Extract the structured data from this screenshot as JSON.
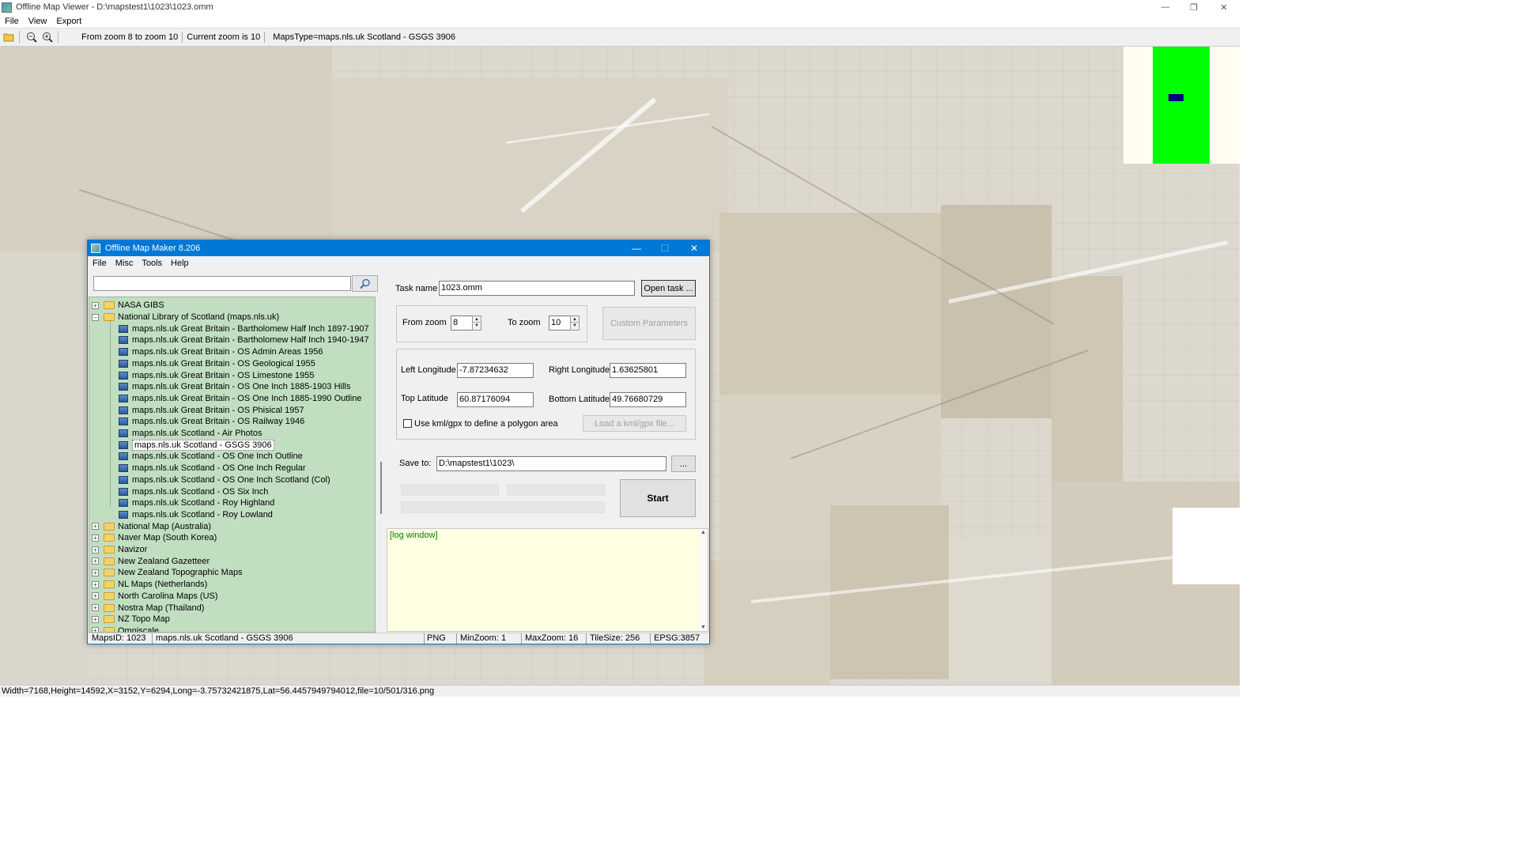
{
  "window": {
    "title": "Offline Map Viewer - D:\\mapstest1\\1023\\1023.omm",
    "controls": {
      "minimize": "—",
      "restore": "❐",
      "close": "✕"
    }
  },
  "menu": [
    "File",
    "View",
    "Export"
  ],
  "toolbar": {
    "icons": [
      "open-folder-icon",
      "zoom-out-icon",
      "zoom-in-icon"
    ],
    "zoom_range": "From zoom 8 to zoom 10",
    "current_zoom": "Current zoom is 10",
    "maps_type": "MapsType=maps.nls.uk Scotland - GSGS 3906"
  },
  "status": "Width=7168,Height=14592,X=3152,Y=6294,Long=-3.75732421875,Lat=56.4457949794012,file=10/501/316.png",
  "colors": {
    "overview_bg": "#fffdf0",
    "overview_area": "#00ff00",
    "overview_marker": "#000080",
    "tree_bg": "#c1dec1",
    "dialog_titlebar": "#0078d7",
    "log_bg": "#ffffe1"
  },
  "dialog": {
    "title": "Offline Map Maker 8.206",
    "controls": {
      "minimize": "—",
      "maximize": "☐",
      "close": "✕"
    },
    "menu": [
      "File",
      "Misc",
      "Tools",
      "Help"
    ],
    "search_value": "",
    "search_icon": "magnifier-icon",
    "tree": [
      {
        "label": "NASA GIBS",
        "type": "folder",
        "expanded": false
      },
      {
        "label": "National Library of Scotland (maps.nls.uk)",
        "type": "folder",
        "expanded": true
      },
      {
        "label": "maps.nls.uk Great Britain - Bartholomew Half Inch 1897-1907",
        "type": "leaf"
      },
      {
        "label": "maps.nls.uk Great Britain - Bartholomew Half Inch 1940-1947",
        "type": "leaf"
      },
      {
        "label": "maps.nls.uk Great Britain - OS Admin Areas 1956",
        "type": "leaf"
      },
      {
        "label": "maps.nls.uk Great Britain - OS Geological 1955",
        "type": "leaf"
      },
      {
        "label": "maps.nls.uk Great Britain - OS Limestone 1955",
        "type": "leaf"
      },
      {
        "label": "maps.nls.uk Great Britain - OS One Inch 1885-1903 Hills",
        "type": "leaf"
      },
      {
        "label": "maps.nls.uk Great Britain - OS One Inch 1885-1990 Outline",
        "type": "leaf"
      },
      {
        "label": "maps.nls.uk Great Britain - OS Phisical 1957",
        "type": "leaf"
      },
      {
        "label": "maps.nls.uk Great Britain - OS Railway 1946",
        "type": "leaf"
      },
      {
        "label": "maps.nls.uk Scotland - Air Photos",
        "type": "leaf"
      },
      {
        "label": "maps.nls.uk Scotland - GSGS 3906",
        "type": "leaf",
        "selected": true
      },
      {
        "label": "maps.nls.uk Scotland - OS One Inch Outline",
        "type": "leaf"
      },
      {
        "label": "maps.nls.uk Scotland - OS One Inch Regular",
        "type": "leaf"
      },
      {
        "label": "maps.nls.uk Scotland - OS One Inch Scotland (Col)",
        "type": "leaf"
      },
      {
        "label": "maps.nls.uk Scotland - OS Six Inch",
        "type": "leaf"
      },
      {
        "label": "maps.nls.uk Scotland - Roy Highland",
        "type": "leaf"
      },
      {
        "label": "maps.nls.uk Scotland - Roy Lowland",
        "type": "leaf"
      },
      {
        "label": "National Map (Australia)",
        "type": "folder",
        "expanded": false
      },
      {
        "label": "Naver Map (South Korea)",
        "type": "folder",
        "expanded": false
      },
      {
        "label": "Navizor",
        "type": "folder",
        "expanded": false
      },
      {
        "label": "New Zealand Gazetteer",
        "type": "folder",
        "expanded": false
      },
      {
        "label": "New Zealand Topographic Maps",
        "type": "folder",
        "expanded": false
      },
      {
        "label": "NL Maps (Netherlands)",
        "type": "folder",
        "expanded": false
      },
      {
        "label": "North Carolina Maps (US)",
        "type": "folder",
        "expanded": false
      },
      {
        "label": "Nostra Map (Thailand)",
        "type": "folder",
        "expanded": false
      },
      {
        "label": "NZ Topo Map",
        "type": "folder",
        "expanded": false
      },
      {
        "label": "Omniscale",
        "type": "folder",
        "expanded": false
      }
    ],
    "task_name_label": "Task name",
    "task_name_value": "1023.omm",
    "open_task_label": "Open task ...",
    "from_zoom_label": "From zoom",
    "from_zoom_value": "8",
    "to_zoom_label": "To zoom",
    "to_zoom_value": "10",
    "custom_params_label": "Custom Parameters",
    "left_lon_label": "Left Longitude",
    "left_lon_value": "-7.87234632",
    "right_lon_label": "Right Longitude",
    "right_lon_value": "1.63625801",
    "top_lat_label": "Top Latitude",
    "top_lat_value": "60.87176094",
    "bottom_lat_label": "Bottom Latitude",
    "bottom_lat_value": "49.76680729",
    "kml_checkbox_label": "Use kml/gpx to define a polygon area",
    "kml_checked": false,
    "load_kml_label": "Load a kml/gpx file...",
    "save_to_label": "Save to:",
    "save_to_value": "D:\\mapstest1\\1023\\",
    "browse_label": "...",
    "start_label": "Start",
    "log_text": "[log window]",
    "status": {
      "maps_id": "MapsID: 1023",
      "maps_name": "maps.nls.uk Scotland - GSGS 3906",
      "format": "PNG",
      "min_zoom": "MinZoom: 1",
      "max_zoom": "MaxZoom: 16",
      "tile_size": "TileSize: 256",
      "epsg": "EPSG:3857"
    }
  }
}
